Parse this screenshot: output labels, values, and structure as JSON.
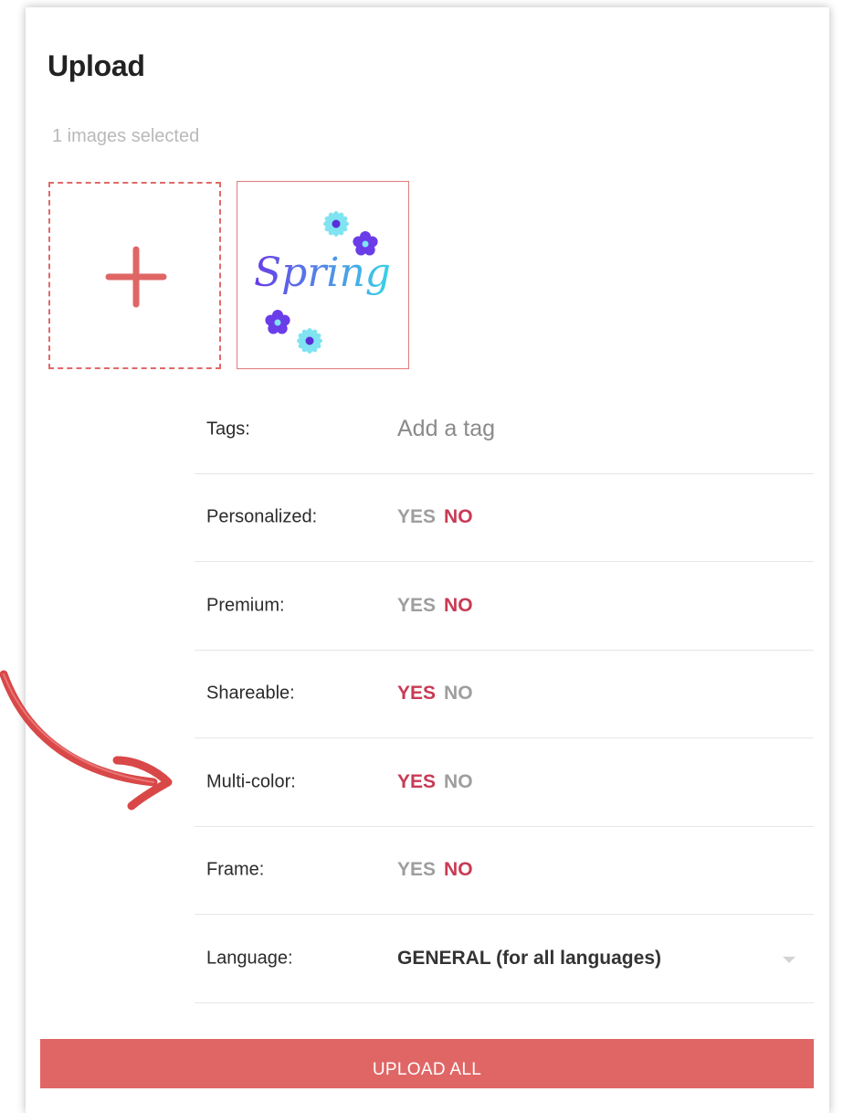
{
  "colors": {
    "accent": "#e06666",
    "active_option": "#c93a54",
    "inactive_option": "#9e9e9e",
    "annotation": "#d94848"
  },
  "header": {
    "title": "Upload",
    "selection_count": "1 images selected"
  },
  "thumbnail": {
    "text": "Spring"
  },
  "form": {
    "tags": {
      "label": "Tags:",
      "placeholder": "Add a tag",
      "value": ""
    },
    "options": [
      {
        "key": "personalized",
        "label": "Personalized:",
        "yes": "YES",
        "no": "NO",
        "selected": "NO"
      },
      {
        "key": "premium",
        "label": "Premium:",
        "yes": "YES",
        "no": "NO",
        "selected": "NO"
      },
      {
        "key": "shareable",
        "label": "Shareable:",
        "yes": "YES",
        "no": "NO",
        "selected": "YES"
      },
      {
        "key": "multicolor",
        "label": "Multi-color:",
        "yes": "YES",
        "no": "NO",
        "selected": "YES"
      },
      {
        "key": "frame",
        "label": "Frame:",
        "yes": "YES",
        "no": "NO",
        "selected": "NO"
      }
    ],
    "language": {
      "label": "Language:",
      "value": "GENERAL (for all languages)"
    }
  },
  "actions": {
    "upload_all_label": "UPLOAD ALL"
  },
  "icons": {
    "add": "plus-icon",
    "dropdown": "chevron-down-icon",
    "annotation": "curved-arrow-icon"
  }
}
